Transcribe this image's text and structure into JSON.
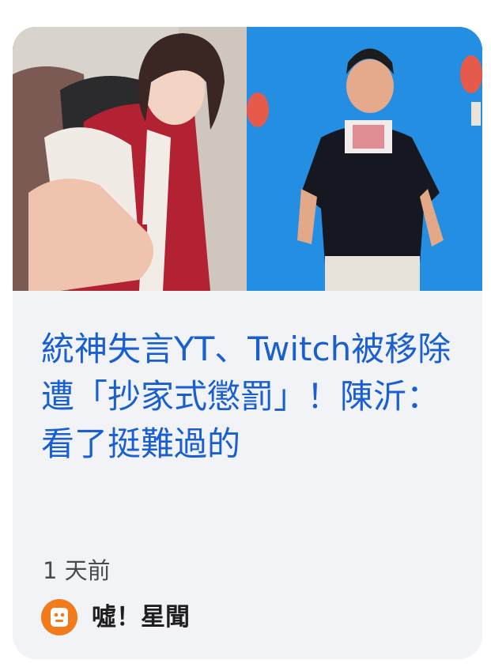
{
  "article": {
    "headline": "統神失言YT、Twitch被移除遭「抄家式懲罰」！陳沂：看了挺難過的",
    "time_ago": "1 天前",
    "source_name": "噓！星聞",
    "hero_image": "photo-collage-woman-pointing-and-man-in-black-tshirt"
  },
  "colors": {
    "headline": "#1a5fd1",
    "card_background": "#f1f3f6",
    "source_logo": "#f07a1c"
  }
}
